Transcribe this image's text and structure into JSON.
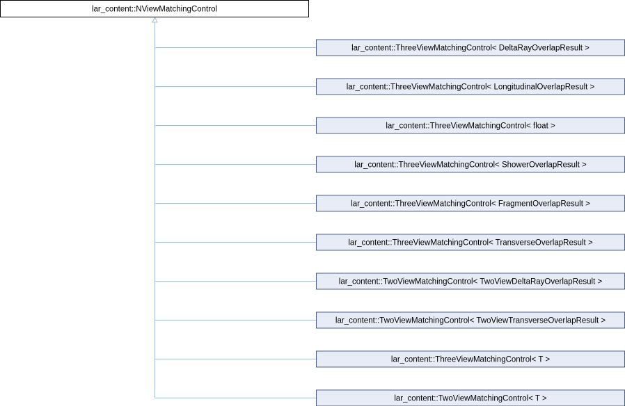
{
  "base_class": {
    "label": "lar_content::NViewMatchingControl"
  },
  "derived_classes": [
    {
      "label": "lar_content::ThreeViewMatchingControl< DeltaRayOverlapResult >"
    },
    {
      "label": "lar_content::ThreeViewMatchingControl< LongitudinalOverlapResult >"
    },
    {
      "label": "lar_content::ThreeViewMatchingControl< float >"
    },
    {
      "label": "lar_content::ThreeViewMatchingControl< ShowerOverlapResult >"
    },
    {
      "label": "lar_content::ThreeViewMatchingControl< FragmentOverlapResult >"
    },
    {
      "label": "lar_content::ThreeViewMatchingControl< TransverseOverlapResult >"
    },
    {
      "label": "lar_content::TwoViewMatchingControl< TwoViewDeltaRayOverlapResult >"
    },
    {
      "label": "lar_content::TwoViewMatchingControl< TwoViewTransverseOverlapResult >"
    },
    {
      "label": "lar_content::ThreeViewMatchingControl< T >"
    },
    {
      "label": "lar_content::TwoViewMatchingControl< T >"
    }
  ],
  "colors": {
    "edge": "#a3bedb",
    "derived_fill": "#e8ecf6",
    "derived_border": "#4c5f8a",
    "base_fill": "#ffffff",
    "base_border": "#000000"
  }
}
